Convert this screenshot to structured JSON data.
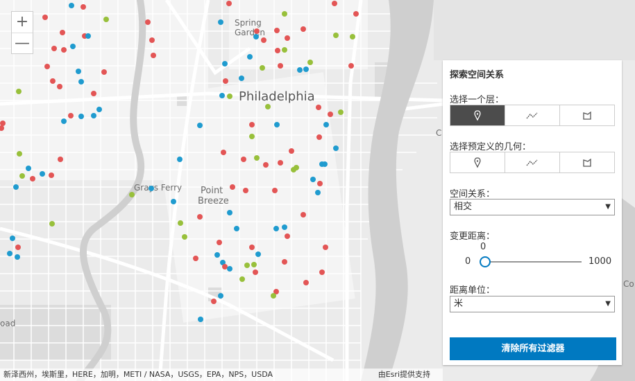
{
  "map": {
    "labels": {
      "philadelphia": "Philadelphia",
      "spring": "Spring",
      "garden": "Garden",
      "grays_ferry": "Grays Ferry",
      "point": "Point",
      "breeze": "Breeze",
      "edge_road": "oad",
      "edge_c": "C",
      "edge_co": "Co"
    },
    "point_colors": {
      "red": "#e35555",
      "blue": "#1f9bcf",
      "green": "#98c03b"
    },
    "zoom_in": "+",
    "zoom_out": "—",
    "attribution_left": "新泽西州，埃斯里，HERE，加明，METI / NASA，USGS，EPA，NPS，USDA",
    "attribution_right": "由Esri提供支持"
  },
  "panel": {
    "title": "探索空间关系",
    "layer_label": "选择一个层：",
    "layer_buttons": [
      {
        "icon": "point-icon",
        "selected": true
      },
      {
        "icon": "polyline-icon",
        "selected": false
      },
      {
        "icon": "polygon-icon",
        "selected": false
      }
    ],
    "geometry_label": "选择预定义的几何：",
    "geometry_buttons": [
      {
        "icon": "point-icon",
        "selected": false
      },
      {
        "icon": "polyline-icon",
        "selected": false
      },
      {
        "icon": "polygon-icon",
        "selected": false
      }
    ],
    "relation_label": "空间关系：",
    "relation_value": "相交",
    "distance_label": "变更距离：",
    "slider": {
      "value": "0",
      "min": "0",
      "max": "1000"
    },
    "unit_label": "距离单位：",
    "unit_value": "米",
    "clear_button": "清除所有过滤器",
    "accent_color": "#0079c1"
  }
}
